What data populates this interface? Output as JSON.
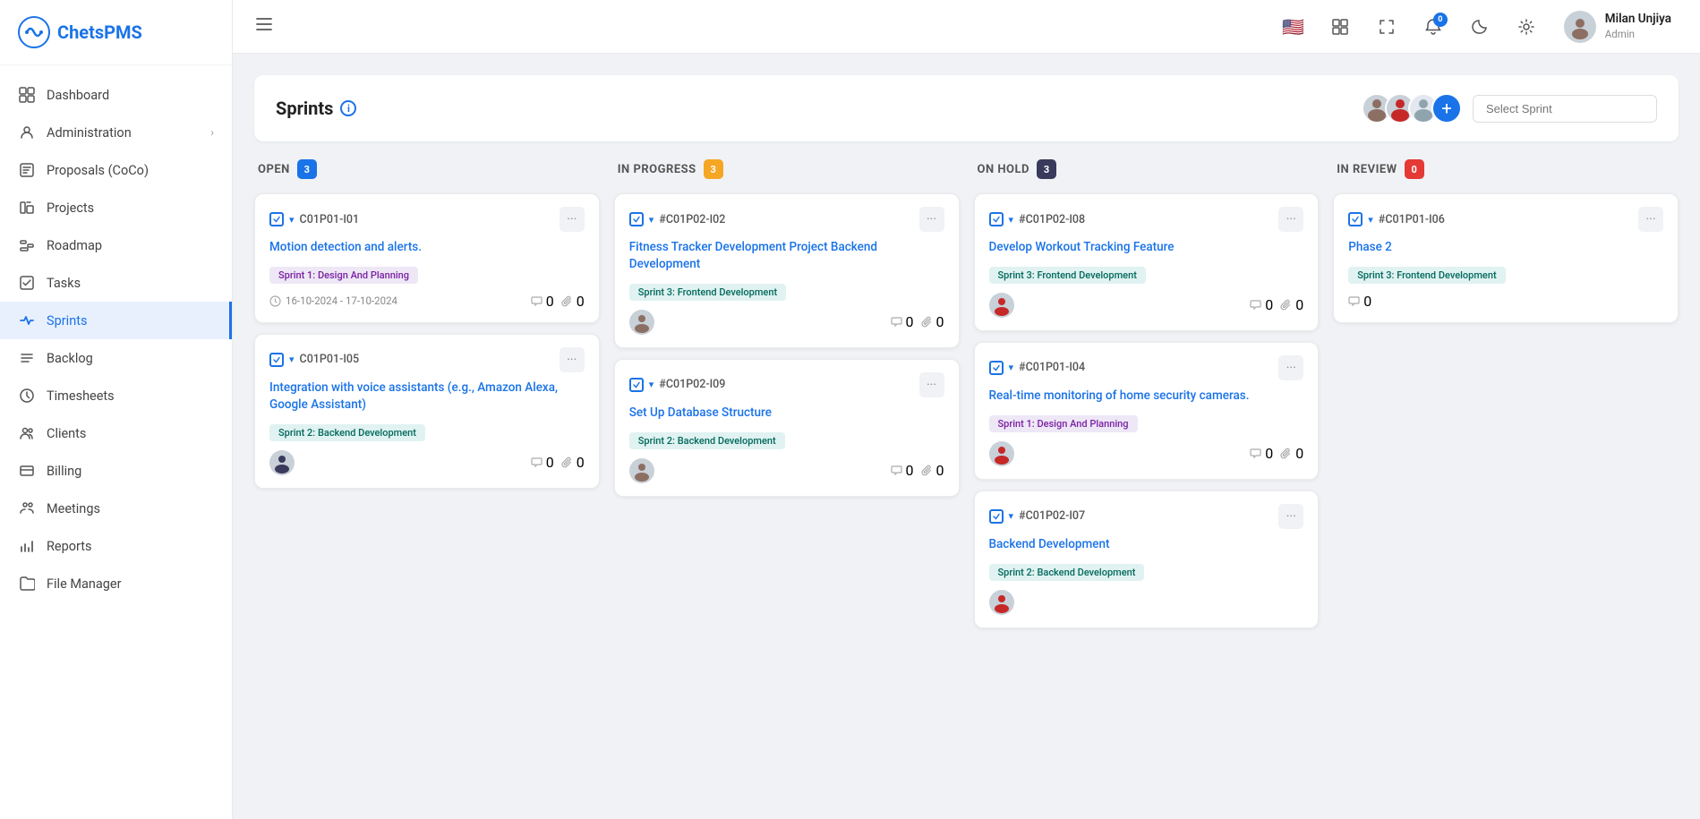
{
  "app": {
    "name": "ChetsPMS"
  },
  "topbar": {
    "hamburger": "≡",
    "notification_count": "0",
    "user": {
      "name": "Milan Unjiya",
      "role": "Admin"
    }
  },
  "sidebar": {
    "items": [
      {
        "id": "dashboard",
        "label": "Dashboard",
        "icon": "dashboard"
      },
      {
        "id": "administration",
        "label": "Administration",
        "icon": "admin",
        "has_chevron": true
      },
      {
        "id": "proposals",
        "label": "Proposals (CoCo)",
        "icon": "proposals"
      },
      {
        "id": "projects",
        "label": "Projects",
        "icon": "projects"
      },
      {
        "id": "roadmap",
        "label": "Roadmap",
        "icon": "roadmap"
      },
      {
        "id": "tasks",
        "label": "Tasks",
        "icon": "tasks"
      },
      {
        "id": "sprints",
        "label": "Sprints",
        "icon": "sprints",
        "active": true
      },
      {
        "id": "backlog",
        "label": "Backlog",
        "icon": "backlog"
      },
      {
        "id": "timesheets",
        "label": "Timesheets",
        "icon": "timesheets"
      },
      {
        "id": "clients",
        "label": "Clients",
        "icon": "clients"
      },
      {
        "id": "billing",
        "label": "Billing",
        "icon": "billing"
      },
      {
        "id": "meetings",
        "label": "Meetings",
        "icon": "meetings"
      },
      {
        "id": "reports",
        "label": "Reports",
        "icon": "reports"
      },
      {
        "id": "file-manager",
        "label": "File Manager",
        "icon": "file-manager"
      }
    ]
  },
  "sprints_page": {
    "title": "Sprints",
    "select_placeholder": "Select Sprint",
    "columns": [
      {
        "id": "open",
        "title": "OPEN",
        "badge": "3",
        "badge_color": "blue",
        "cards": [
          {
            "id": "C01P01-I01",
            "title": "Motion detection and alerts.",
            "sprint_tag": "Sprint 1: Design And Planning",
            "tag_color": "purple",
            "has_date": true,
            "date": "16-10-2024 - 17-10-2024",
            "comments": "0",
            "attachments": "0",
            "avatar_color": "dark"
          },
          {
            "id": "C01P01-I05",
            "title": "Integration with voice assistants (e.g., Amazon Alexa, Google Assistant)",
            "sprint_tag": "Sprint 2: Backend Development",
            "tag_color": "teal",
            "has_date": false,
            "comments": "0",
            "attachments": "0",
            "avatar_color": "dark"
          }
        ]
      },
      {
        "id": "in-progress",
        "title": "IN PROGRESS",
        "badge": "3",
        "badge_color": "orange",
        "cards": [
          {
            "id": "C01P02-I02",
            "title": "Fitness Tracker Development Project Backend Development",
            "sprint_tag": "Sprint 3: Frontend Development",
            "tag_color": "teal",
            "has_date": false,
            "comments": "0",
            "attachments": "0",
            "avatar_color": "brown"
          },
          {
            "id": "C01P02-I09",
            "title": "Set Up Database Structure",
            "sprint_tag": "Sprint 2: Backend Development",
            "tag_color": "teal",
            "has_date": false,
            "comments": "0",
            "attachments": "0",
            "avatar_color": "brown"
          }
        ]
      },
      {
        "id": "on-hold",
        "title": "ON HOLD",
        "badge": "3",
        "badge_color": "dark",
        "cards": [
          {
            "id": "C01P02-I08",
            "title": "Develop Workout Tracking Feature",
            "sprint_tag": "Sprint 3: Frontend Development",
            "tag_color": "teal",
            "has_date": false,
            "comments": "0",
            "attachments": "0",
            "avatar_color": "red"
          },
          {
            "id": "C01P01-I04",
            "title": "Real-time monitoring of home security cameras.",
            "sprint_tag": "Sprint 1: Design And Planning",
            "tag_color": "purple",
            "has_date": false,
            "comments": "0",
            "attachments": "0",
            "avatar_color": "red"
          },
          {
            "id": "C01P02-I07",
            "title": "Backend Development",
            "sprint_tag": "Sprint 2: Backend Development",
            "tag_color": "teal",
            "has_date": false,
            "comments": null,
            "attachments": null,
            "avatar_color": "red"
          }
        ]
      },
      {
        "id": "in-review",
        "title": "IN REVIEW",
        "badge": "0",
        "badge_color": "red",
        "cards": [
          {
            "id": "C01P01-I06",
            "title": "Phase 2",
            "sprint_tag": "Sprint 3: Frontend Development",
            "tag_color": "teal",
            "has_date": false,
            "comments": "0",
            "attachments": null,
            "avatar_color": "dark"
          }
        ]
      }
    ]
  }
}
